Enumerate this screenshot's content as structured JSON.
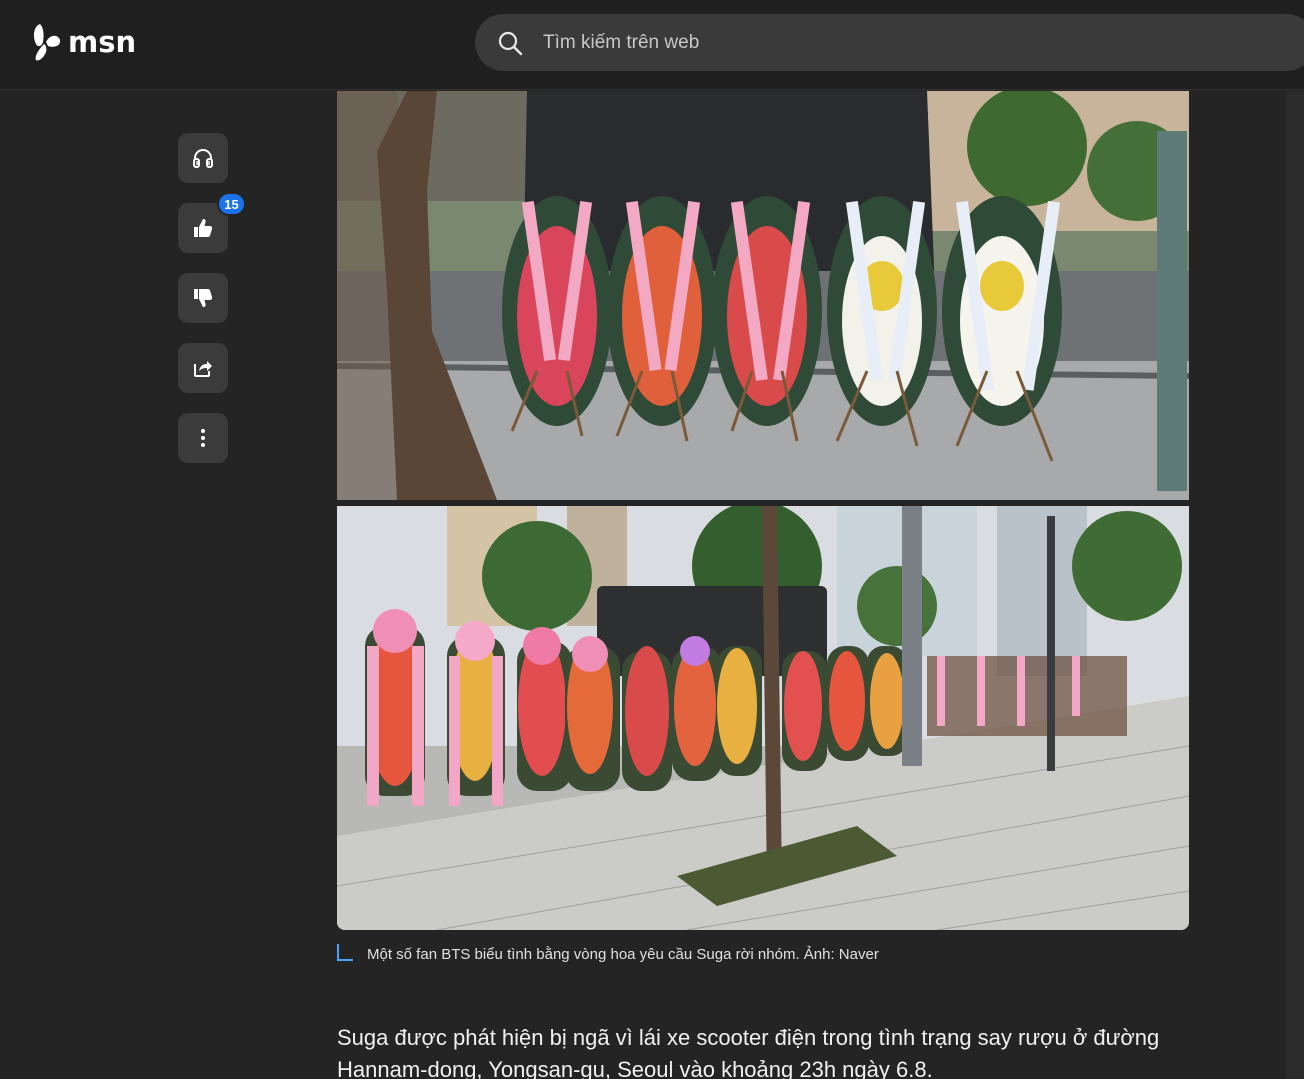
{
  "brand": {
    "name": "msn"
  },
  "search": {
    "placeholder": "Tìm kiếm trên web"
  },
  "rail": {
    "listen_label": "Listen",
    "like_count": "15",
    "icons": [
      "headphones-icon",
      "thumbs-up-icon",
      "thumbs-down-icon",
      "share-icon",
      "more-icon"
    ]
  },
  "article": {
    "caption": "Một số fan BTS biểu tình bằng vòng hoa yêu cầu Suga rời nhóm. Ảnh: Naver",
    "paragraph": "Suga được phát hiện bị ngã vì lái xe scooter điện trong tình trạng say rượu ở đường Hannam-dong, Yongsan-gu, Seoul vào khoảng 23h ngày 6.8."
  },
  "colors": {
    "accent": "#1a73e8",
    "caption_mark": "#4aa3ff",
    "background": "#242424"
  }
}
